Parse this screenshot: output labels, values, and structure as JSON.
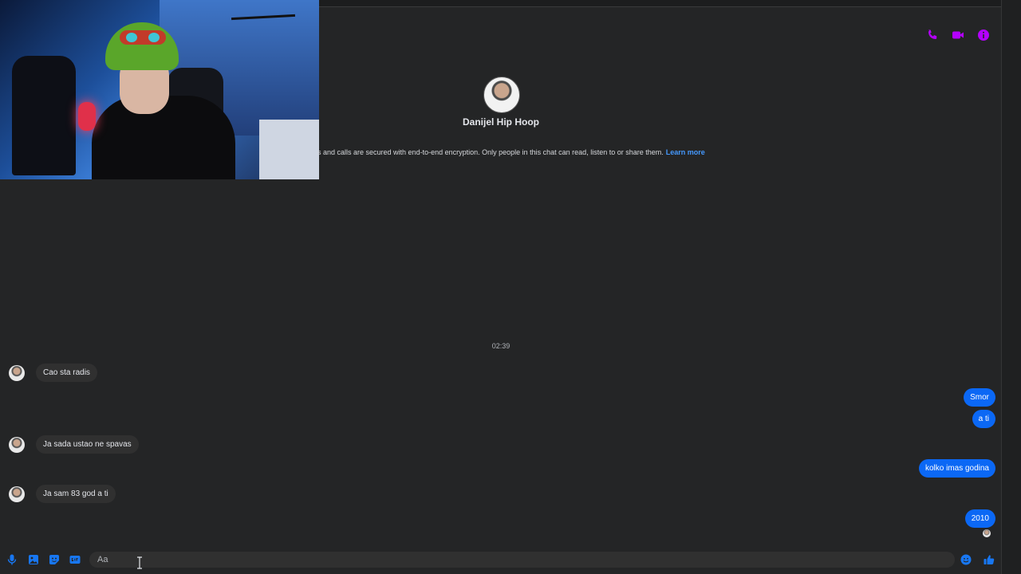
{
  "header": {
    "contact_name": "Danijel Hip Hoop",
    "encryption_text": "s and calls are secured with end-to-end encryption. Only people in this chat can read, listen to or share them.",
    "learn_more": "Learn more",
    "accent_color": "#b400ff",
    "icons": [
      "phone-icon",
      "video-icon",
      "info-icon"
    ]
  },
  "conversation": {
    "timestamp": "02:39",
    "incoming": [
      {
        "text": "Cao sta radis"
      },
      {
        "text": "Ja sada ustao ne spavas"
      },
      {
        "text": "Ja sam 83 god a ti"
      }
    ],
    "outgoing": [
      {
        "text": "Smor"
      },
      {
        "text": "a ti"
      },
      {
        "text": "kolko imas godina"
      },
      {
        "text": "2010"
      }
    ],
    "outgoing_color": "#0b68f5"
  },
  "composer": {
    "placeholder": "Aa",
    "accent_color": "#1877f2",
    "icons": [
      "microphone-icon",
      "image-icon",
      "sticker-icon",
      "gif-icon",
      "emoji-icon",
      "thumbs-up-icon"
    ]
  }
}
